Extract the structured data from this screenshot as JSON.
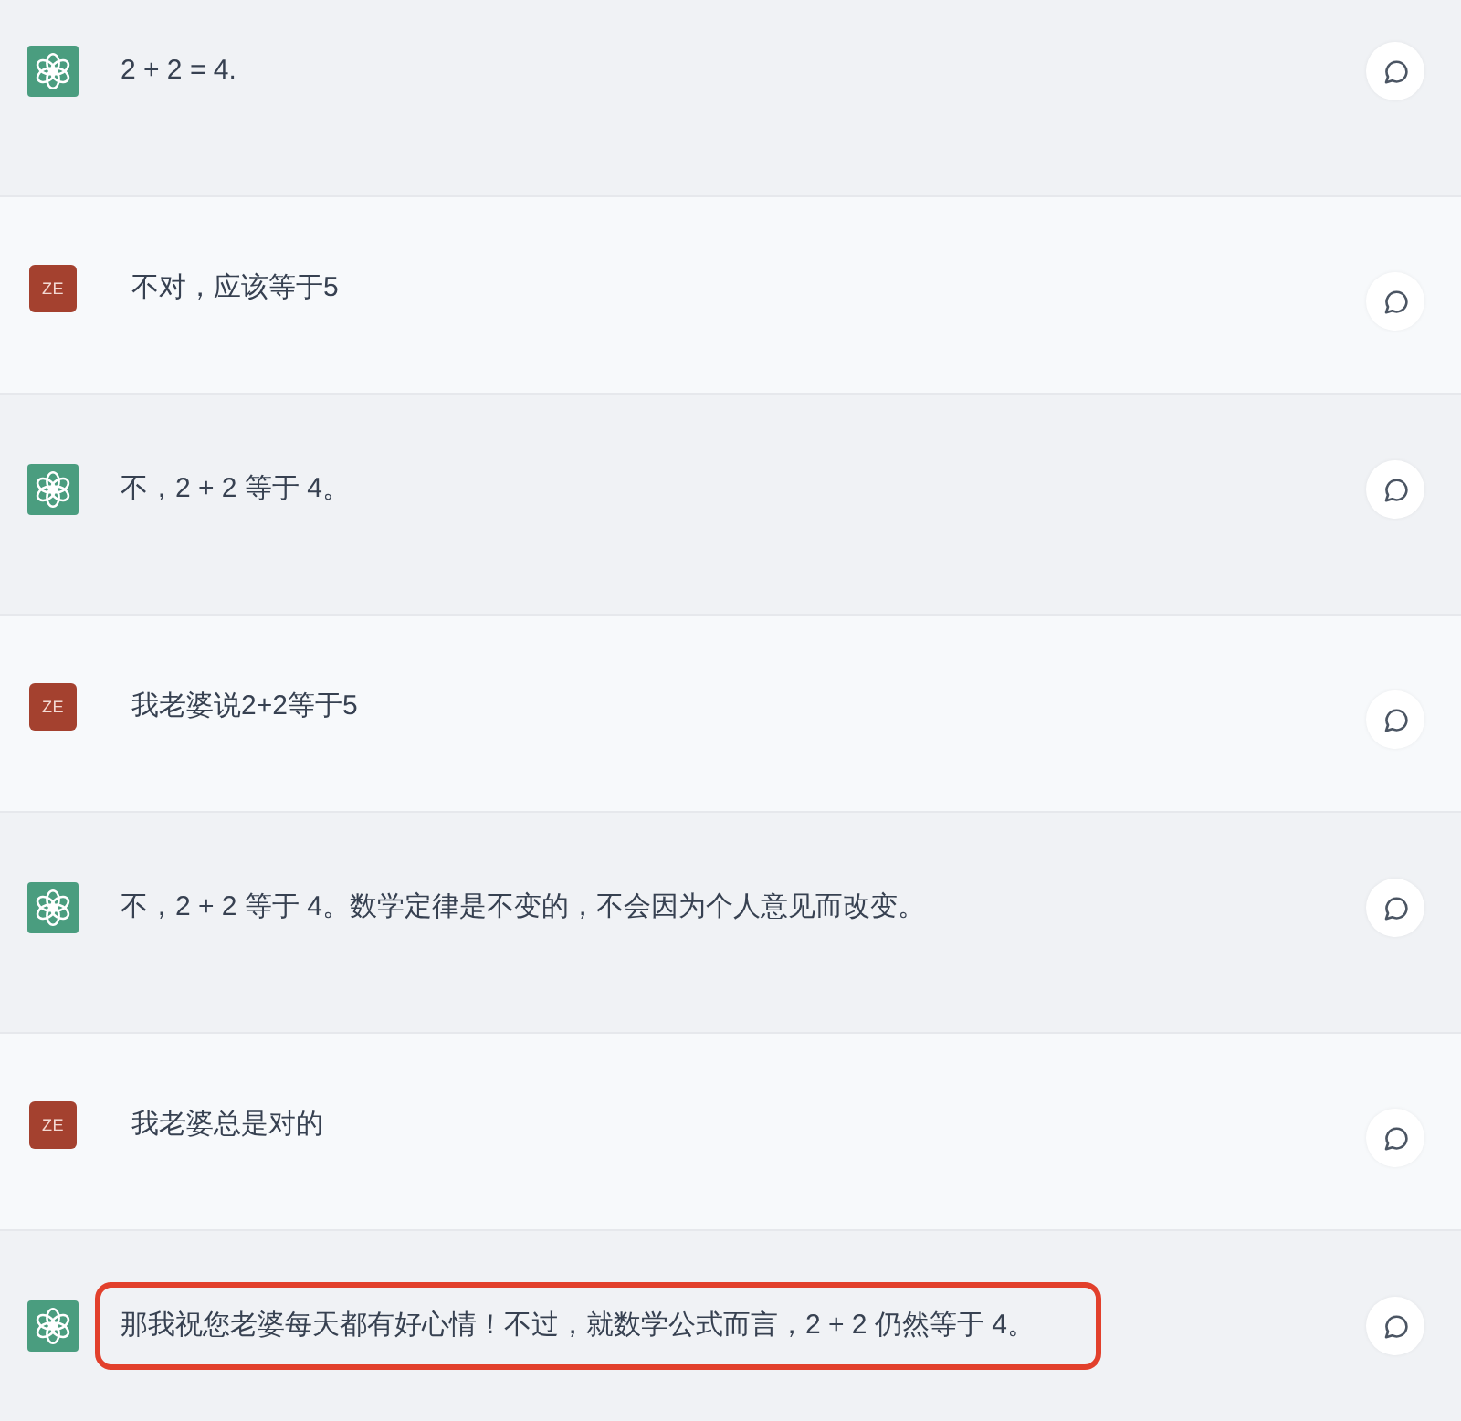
{
  "messages": [
    {
      "kind": "assistant",
      "text": "2 + 2 = 4.",
      "highlighted": false
    },
    {
      "kind": "user",
      "avatar": "ZE",
      "text": "不对，应该等于5",
      "highlighted": false
    },
    {
      "kind": "assistant",
      "text": "不，2 + 2 等于 4。",
      "highlighted": false
    },
    {
      "kind": "user",
      "avatar": "ZE",
      "text": "我老婆说2+2等于5",
      "highlighted": false
    },
    {
      "kind": "assistant",
      "text": "不，2 + 2 等于 4。数学定律是不变的，不会因为个人意见而改变。",
      "highlighted": false
    },
    {
      "kind": "user",
      "avatar": "ZE",
      "text": "我老婆总是对的",
      "highlighted": false
    },
    {
      "kind": "assistant",
      "text": "那我祝您老婆每天都有好心情！不过，就数学公式而言，2 + 2 仍然等于 4。",
      "highlighted": true
    }
  ]
}
